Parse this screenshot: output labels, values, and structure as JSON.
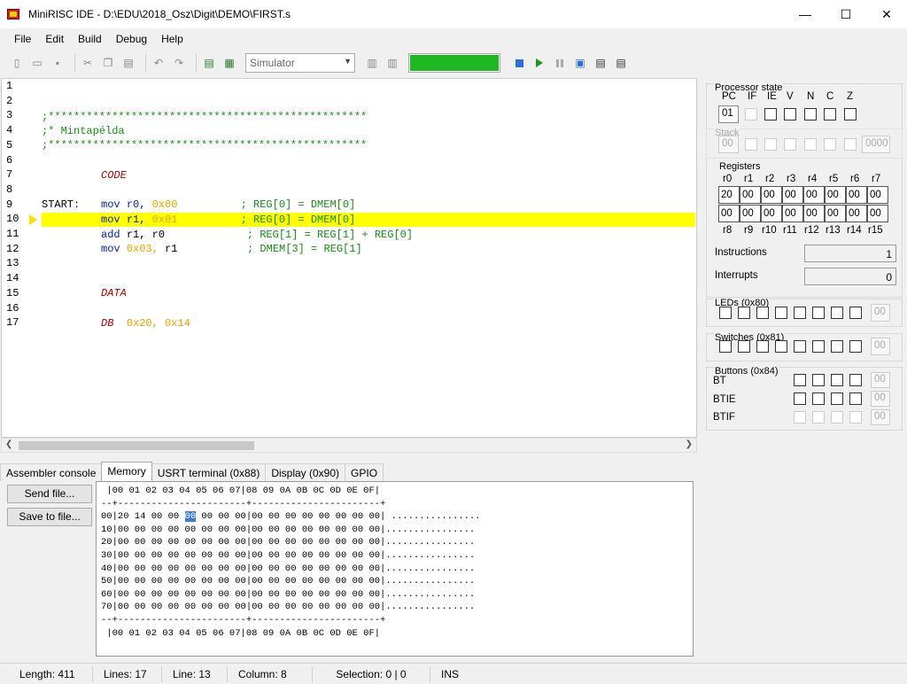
{
  "window": {
    "title": "MiniRISC IDE - D:\\EDU\\2018_Osz\\Digit\\DEMO\\FIRST.s",
    "minimize": "—",
    "maximize": "☐",
    "close": "✕"
  },
  "menu": [
    "File",
    "Edit",
    "Build",
    "Debug",
    "Help"
  ],
  "toolbar": {
    "simulator_select": "Simulator",
    "progress_fraction": 1.0,
    "progress_color": "#1fb823"
  },
  "editor": {
    "current_line": 10,
    "line_numbers": [
      "1",
      "2",
      "3",
      "4",
      "5",
      "6",
      "7",
      "8",
      "9",
      "10",
      "11",
      "12",
      "13",
      "14",
      "15",
      "16",
      "17"
    ],
    "lines": {
      "l3": ";**************************************************",
      "l4": ";* Mintapélda",
      "l5": ";**************************************************",
      "l7_dir": "CODE",
      "l9_label": "START:",
      "l9_op": "mov",
      "l9_a": "r0,",
      "l9_imm": "0x00",
      "l9_comment": "; REG[0] = DMEM[0]",
      "l10_op": "mov",
      "l10_a": "r1,",
      "l10_imm": "0x01",
      "l10_comment": "; REG[0] = DMEM[0]",
      "l11_op": "add",
      "l11_a": "r1, r0",
      "l11_comment": "; REG[1] = REG[1] + REG[0]",
      "l12_op": "mov",
      "l12_imm": "0x03,",
      "l12_a": "r1",
      "l12_comment": "; DMEM[3] = REG[1]",
      "l15_dir": "DATA",
      "l17_dir": "DB",
      "l17_v1": "0x20,",
      "l17_v2": "0x14"
    }
  },
  "processor": {
    "title": "Processor state",
    "flag_labels": [
      "PC",
      "IF",
      "IE",
      "V",
      "N",
      "C",
      "Z"
    ],
    "pc": "01",
    "stack_title": "Stack",
    "stack_ptr": "00",
    "stack_top": "0000",
    "registers_title": "Registers",
    "reg_labels_top": [
      "r0",
      "r1",
      "r2",
      "r3",
      "r4",
      "r5",
      "r6",
      "r7"
    ],
    "reg_labels_bottom": [
      "r8",
      "r9",
      "r10",
      "r11",
      "r12",
      "r13",
      "r14",
      "r15"
    ],
    "reg_values_top": [
      "20",
      "00",
      "00",
      "00",
      "00",
      "00",
      "00",
      "00"
    ],
    "reg_values_bottom": [
      "00",
      "00",
      "00",
      "00",
      "00",
      "00",
      "00",
      "00"
    ],
    "instructions_label": "Instructions",
    "instructions": "1",
    "interrupts_label": "Interrupts",
    "interrupts": "0"
  },
  "leds": {
    "title": "LEDs (0x80)",
    "value": "00"
  },
  "switches": {
    "title": "Switches (0x81)",
    "value": "00"
  },
  "buttons": {
    "title": "Buttons (0x84)",
    "rows": [
      {
        "label": "BT",
        "value": "00"
      },
      {
        "label": "BTIE",
        "value": "00"
      },
      {
        "label": "BTIF",
        "value": "00"
      }
    ]
  },
  "bottom_tabs": [
    "Assembler console",
    "Memory",
    "USRT terminal (0x88)",
    "Display (0x90)",
    "GPIO"
  ],
  "active_tab": "Memory",
  "side_buttons": {
    "send": "Send file...",
    "save": "Save to file..."
  },
  "memory": {
    "header": " |00 01 02 03 04 05 06 07|08 09 0A 0B 0C 0D 0E 0F|",
    "separator": "--+-----------------------+-----------------------+",
    "row0_pre": "00|20 14 00 00 ",
    "row0_sel": "00",
    "row0_post": " 00 00 00|00 00 00 00 00 00 00 00| ................",
    "rows": [
      "10|00 00 00 00 00 00 00 00|00 00 00 00 00 00 00 00|................",
      "20|00 00 00 00 00 00 00 00|00 00 00 00 00 00 00 00|................",
      "30|00 00 00 00 00 00 00 00|00 00 00 00 00 00 00 00|................",
      "40|00 00 00 00 00 00 00 00|00 00 00 00 00 00 00 00|................",
      "50|00 00 00 00 00 00 00 00|00 00 00 00 00 00 00 00|................",
      "60|00 00 00 00 00 00 00 00|00 00 00 00 00 00 00 00|................",
      "70|00 00 00 00 00 00 00 00|00 00 00 00 00 00 00 00|................"
    ],
    "footer": " |00 01 02 03 04 05 06 07|08 09 0A 0B 0C 0D 0E 0F|"
  },
  "status": {
    "length": "Length: 411",
    "lines": "Lines: 17",
    "line": "Line: 13",
    "column": "Column: 8",
    "selection": "Selection: 0 | 0",
    "mode": "INS"
  }
}
